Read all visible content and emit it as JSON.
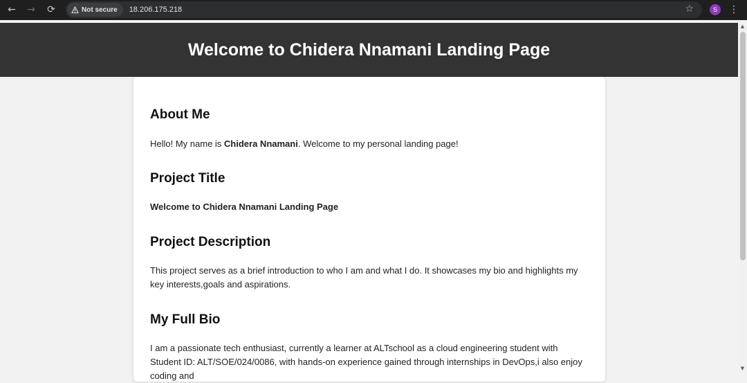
{
  "browser": {
    "back_icon": "←",
    "forward_icon": "→",
    "reload_icon": "⟳",
    "security_label": "Not secure",
    "url": "18.206.175.218",
    "bookmark_icon": "☆",
    "profile_initial": "S",
    "menu_icon": "⋮"
  },
  "header": {
    "title": "Welcome to Chidera Nnamani Landing Page"
  },
  "about": {
    "heading": "About Me",
    "text_before": "Hello! My name is ",
    "name": "Chidera Nnamani",
    "text_after": ". Welcome to my personal landing page!"
  },
  "project": {
    "title_heading": "Project Title",
    "title_value": "Welcome to Chidera Nnamani Landing Page",
    "description_heading": "Project Description",
    "description": "This project serves as a brief introduction to who I am and what I do. It showcases my bio and highlights my key interests,goals and aspirations."
  },
  "bio": {
    "heading": "My Full Bio",
    "text": "I am a passionate tech enthusiast, currently a learner at ALTschool as a cloud engineering student with Student ID: ALT/SOE/024/0086, with hands-on experience gained through internships in DevOps,i also enjoy coding and"
  },
  "colors": {
    "header_bg": "#333333",
    "page_bg": "#f2f2f2",
    "card_bg": "#ffffff"
  }
}
